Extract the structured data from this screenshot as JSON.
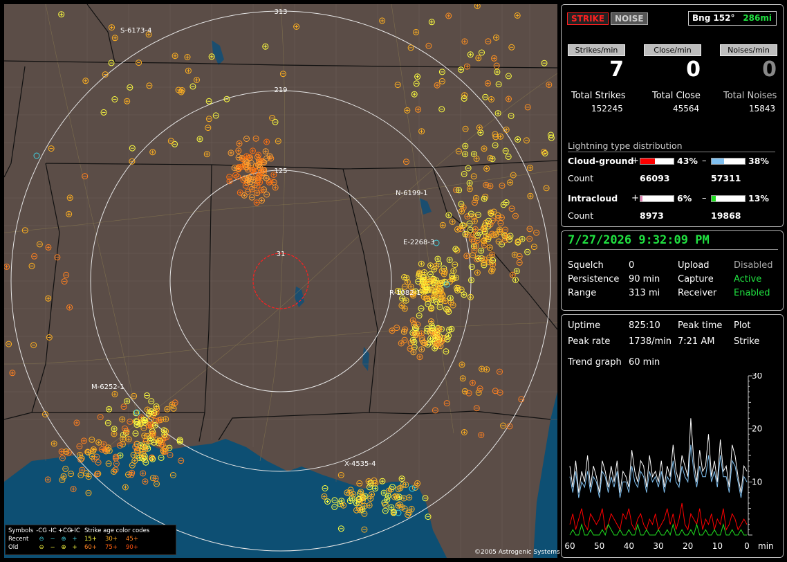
{
  "map": {
    "ring_labels": [
      "313",
      "219",
      "125",
      "31"
    ],
    "stations": [
      "S-6173-4",
      "N-6199-1",
      "E-2268-3",
      "R-1082-1",
      "M-6252-1",
      "X-4535-4"
    ],
    "copyright": "©2005 Astrogenic Systems",
    "legend": {
      "symbols_label": "Symbols",
      "col_neg_cg": "-CG",
      "col_neg_ic": "-IC",
      "col_pos_cg": "+CG",
      "col_pos_ic": "+IC",
      "age_label": "Strike age color codes",
      "recent_label": "Recent",
      "old_label": "Old",
      "recent_ages": [
        "15+",
        "30+",
        "45+"
      ],
      "old_ages": [
        "60+",
        "75+",
        "90+"
      ],
      "colors": {
        "recent": "#40d0e0",
        "old": "#ffff40",
        "age15": "#ffff40",
        "age30": "#ffb020",
        "age45": "#ff8020",
        "age60": "#ff8020",
        "age75": "#ff6010",
        "age90": "#ff5010"
      }
    }
  },
  "header": {
    "strike_tab": "STRIKE",
    "noise_tab": "NOISE",
    "bearing": "Bng 152°",
    "distance": "286mi"
  },
  "rates": {
    "strikes_label": "Strikes/min",
    "close_label": "Close/min",
    "noises_label": "Noises/min",
    "strikes": "7",
    "close": "0",
    "noises": "0"
  },
  "totals": {
    "strikes_label": "Total Strikes",
    "close_label": "Total Close",
    "noises_label": "Total Noises",
    "strikes": "152245",
    "close": "45564",
    "noises": "15843"
  },
  "distribution": {
    "title": "Lightning type distribution",
    "cg_label": "Cloud-ground",
    "ic_label": "Intracloud",
    "count_label": "Count",
    "cg_pos_sign": "+",
    "cg_neg_sign": "–",
    "ic_pos_sign": "+",
    "ic_neg_sign": "–",
    "cg_pos_pct": "43%",
    "cg_neg_pct": "38%",
    "ic_pos_pct": "6%",
    "ic_neg_pct": "13%",
    "cg_pos_fraction": 0.43,
    "cg_neg_fraction": 0.38,
    "ic_pos_fraction": 0.06,
    "ic_neg_fraction": 0.13,
    "cg_pos_count": "66093",
    "cg_neg_count": "57311",
    "ic_pos_count": "8973",
    "ic_neg_count": "19868",
    "colors": {
      "cg_pos": "#ff0000",
      "cg_neg": "#80c0f0",
      "ic_pos": "#e080b0",
      "ic_neg": "#20e020"
    }
  },
  "status": {
    "datetime": "7/27/2026 9:32:09 PM",
    "squelch_label": "Squelch",
    "squelch": "0",
    "persistence_label": "Persistence",
    "persistence": "90 min",
    "range_label": "Range",
    "range": "313 mi",
    "upload_label": "Upload",
    "upload": "Disabled",
    "capture_label": "Capture",
    "capture": "Active",
    "receiver_label": "Receiver",
    "receiver": "Enabled"
  },
  "stats": {
    "uptime_label": "Uptime",
    "uptime": "825:10",
    "peak_time_label": "Peak time",
    "plot_label": "Plot",
    "peak_rate_label": "Peak rate",
    "peak_rate": "1738/min",
    "peak_time": "7:21 AM",
    "plot": "Strike",
    "trend_label": "Trend graph",
    "trend": "60 min"
  },
  "chart_data": {
    "type": "line",
    "x": [
      60,
      59,
      58,
      57,
      56,
      55,
      54,
      53,
      52,
      51,
      50,
      49,
      48,
      47,
      46,
      45,
      44,
      43,
      42,
      41,
      40,
      39,
      38,
      37,
      36,
      35,
      34,
      33,
      32,
      31,
      30,
      29,
      28,
      27,
      26,
      25,
      24,
      23,
      22,
      21,
      20,
      19,
      18,
      17,
      16,
      15,
      14,
      13,
      12,
      11,
      10,
      9,
      8,
      7,
      6,
      5,
      4,
      3,
      2,
      1,
      0
    ],
    "x_ticks": [
      "60",
      "50",
      "40",
      "30",
      "20",
      "10",
      "0"
    ],
    "x_unit": "min",
    "y_ticks": [
      "30",
      "20",
      "10"
    ],
    "ylim": [
      0,
      30
    ],
    "series": [
      {
        "color": "#ffffff",
        "values": [
          13,
          9,
          14,
          8,
          12,
          10,
          15,
          9,
          13,
          11,
          8,
          14,
          12,
          9,
          13,
          10,
          14,
          8,
          12,
          11,
          9,
          16,
          12,
          10,
          14,
          13,
          9,
          15,
          11,
          12,
          10,
          14,
          9,
          13,
          11,
          17,
          12,
          10,
          15,
          13,
          11,
          22,
          14,
          10,
          16,
          12,
          13,
          19,
          11,
          14,
          10,
          18,
          12,
          13,
          9,
          17,
          15,
          11,
          8,
          13,
          12
        ]
      },
      {
        "color": "#80c0f0",
        "values": [
          11,
          8,
          12,
          7,
          10,
          9,
          12,
          8,
          11,
          10,
          7,
          12,
          11,
          8,
          11,
          9,
          12,
          7,
          10,
          10,
          8,
          13,
          10,
          9,
          12,
          11,
          8,
          12,
          10,
          11,
          9,
          12,
          8,
          11,
          10,
          14,
          10,
          9,
          13,
          11,
          10,
          17,
          12,
          9,
          13,
          11,
          11,
          15,
          10,
          12,
          9,
          15,
          11,
          11,
          8,
          14,
          13,
          10,
          7,
          11,
          10
        ]
      },
      {
        "color": "#ff0000",
        "values": [
          2,
          4,
          1,
          3,
          5,
          2,
          1,
          4,
          3,
          2,
          3,
          5,
          1,
          2,
          4,
          3,
          2,
          1,
          4,
          3,
          5,
          2,
          1,
          3,
          4,
          2,
          1,
          3,
          2,
          4,
          1,
          2,
          3,
          5,
          2,
          4,
          1,
          3,
          6,
          2,
          1,
          4,
          3,
          2,
          5,
          1,
          3,
          2,
          4,
          1,
          3,
          2,
          5,
          1,
          2,
          4,
          3,
          1,
          2,
          3,
          2
        ]
      },
      {
        "color": "#20e020",
        "values": [
          0,
          1,
          0,
          0,
          2,
          0,
          0,
          1,
          0,
          0,
          0,
          1,
          0,
          2,
          1,
          0,
          0,
          1,
          0,
          0,
          1,
          0,
          0,
          2,
          0,
          0,
          1,
          0,
          0,
          0,
          1,
          0,
          0,
          1,
          0,
          2,
          0,
          0,
          1,
          0,
          0,
          1,
          0,
          2,
          0,
          0,
          1,
          0,
          0,
          1,
          0,
          0,
          2,
          0,
          0,
          1,
          0,
          0,
          1,
          0,
          0
        ]
      }
    ]
  }
}
